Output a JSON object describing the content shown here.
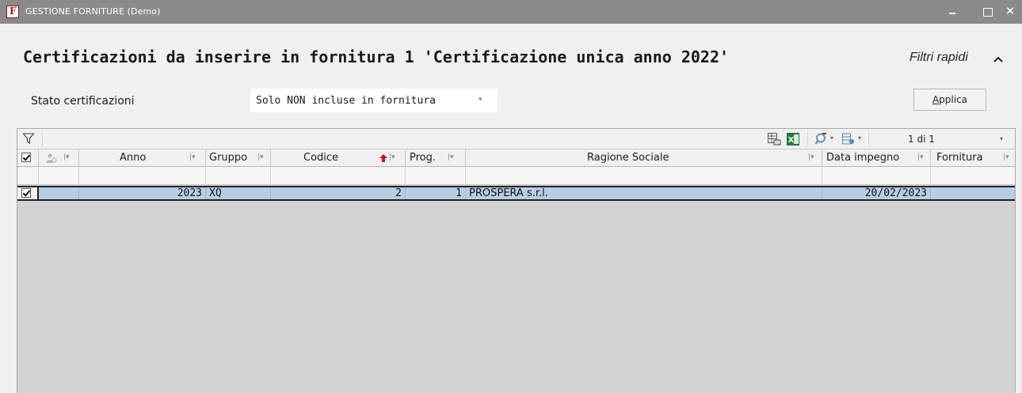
{
  "window": {
    "title": "GESTIONE FORNITURE  (Demo)",
    "close_glyph": "✕"
  },
  "page": {
    "title": "Certificazioni da inserire in fornitura 1 'Certificazione unica anno 2022'",
    "filters_label": "Filtri rapidi"
  },
  "filters": {
    "stato_label": "Stato certificazioni",
    "stato_value": "Solo NON incluse in fornitura",
    "applica_label_first": "A",
    "applica_label_rest": "pplica"
  },
  "toolbar": {
    "pager": "1 di 1"
  },
  "columns": [
    {
      "key": "select",
      "label": ""
    },
    {
      "key": "owner",
      "label": ""
    },
    {
      "key": "anno",
      "label": "Anno"
    },
    {
      "key": "gruppo",
      "label": "Gruppo"
    },
    {
      "key": "codice",
      "label": "Codice"
    },
    {
      "key": "prog",
      "label": "Prog."
    },
    {
      "key": "ragione_sociale",
      "label": "Ragione Sociale"
    },
    {
      "key": "data_impegno",
      "label": "Data impegno"
    },
    {
      "key": "fornitura",
      "label": "Fornitura"
    }
  ],
  "sort": {
    "column": "codice",
    "direction": "asc"
  },
  "rows": [
    {
      "checked": true,
      "anno": "2023",
      "gruppo": "XQ",
      "codice": "2",
      "prog": "1",
      "ragione_sociale": "PROSPERA s.r.l.",
      "data_impegno": "20/02/2023",
      "fornitura": ""
    }
  ],
  "colors": {
    "titlebar": "#8a8a8a",
    "grid_background": "#d3d3d3",
    "selected_row": "#b7cde4",
    "sort_arrow": "#c0141a",
    "excel_green": "#1d7a3a"
  }
}
